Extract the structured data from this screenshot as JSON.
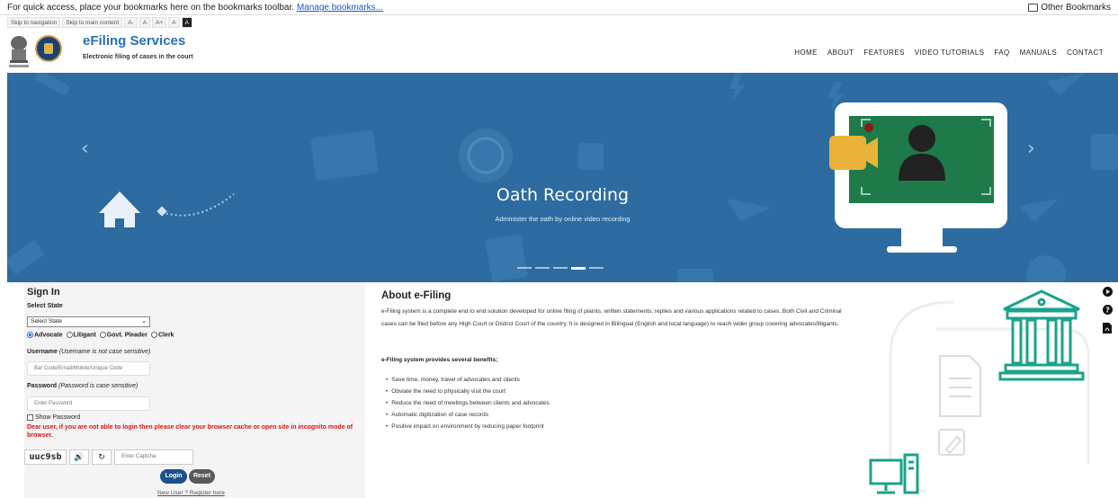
{
  "bookmarks": {
    "message": "For quick access, place your bookmarks here on the bookmarks toolbar.",
    "link": "Manage bookmarks...",
    "other": "Other Bookmarks"
  },
  "accessibility": {
    "skip_nav": "Skip to navigation",
    "skip_main": "Skip to main content",
    "font_minus": "A-",
    "font_normal": "A",
    "font_plus": "A+",
    "contrast_light": "A",
    "contrast_dark": "A"
  },
  "header": {
    "title": "eFiling Services",
    "subtitle": "Electronic filing of cases in the court",
    "nav": [
      "HOME",
      "ABOUT",
      "FEATURES",
      "VIDEO TUTORIALS",
      "FAQ",
      "MANUALS",
      "CONTACT"
    ]
  },
  "carousel": {
    "title": "Oath Recording",
    "subtitle": "Administer the oath by online video recording",
    "prev": "‹",
    "next": "›",
    "slide_count": 5,
    "active_slide": 4,
    "colors": {
      "bg": "#2d6ba0",
      "screen": "#1f7a4a",
      "camera": "#e9b33a"
    }
  },
  "signin": {
    "title": "Sign In",
    "state_label": "Select State",
    "state_value": "Select State",
    "roles": [
      "Advocate",
      "Litigant",
      "Govt. Pleader",
      "Clerk"
    ],
    "selected_role": "Advocate",
    "username_label": "Username",
    "username_note": "(Username is not case sensitive)",
    "username_placeholder": "Bar Code/Email/Mobile/Unique Code",
    "password_label": "Password",
    "password_note": "(Password is case sensitive)",
    "password_placeholder": "Enter Password",
    "show_password": "Show Password",
    "warning": "Dear user, if you are not able to login then please clear your browser cache or open site in incognito mode of browser.",
    "captcha_text": "uuc9sb",
    "captcha_placeholder": "Enter Captcha",
    "login": "Login",
    "reset": "Reset",
    "register": "New User ? Register here"
  },
  "about": {
    "title": "About e-Filing",
    "paragraph": "e-Filing system is a complete end to end solution developed for online filing of plaints, written statements, replies and various applications related to cases. Both Civil and Criminal cases can be filed before any High Court or District Court of the country. It is designed in Bilingual (English and local language) to reach wider group covering advocates/litigants.",
    "benefits_heading": "e-Filing system provides several benefits;",
    "benefits": [
      "Save time, money, travel of advocates and clients",
      "Obviate the need to physically visit the court",
      "Reduce the need of meetings between clients and advocates",
      "Automatic digitization of case records",
      "Positive impact on environment by reducing paper footprint"
    ],
    "accent": "#1aa38a"
  },
  "side_icons": [
    "play-icon",
    "help-icon",
    "pdf-icon"
  ]
}
